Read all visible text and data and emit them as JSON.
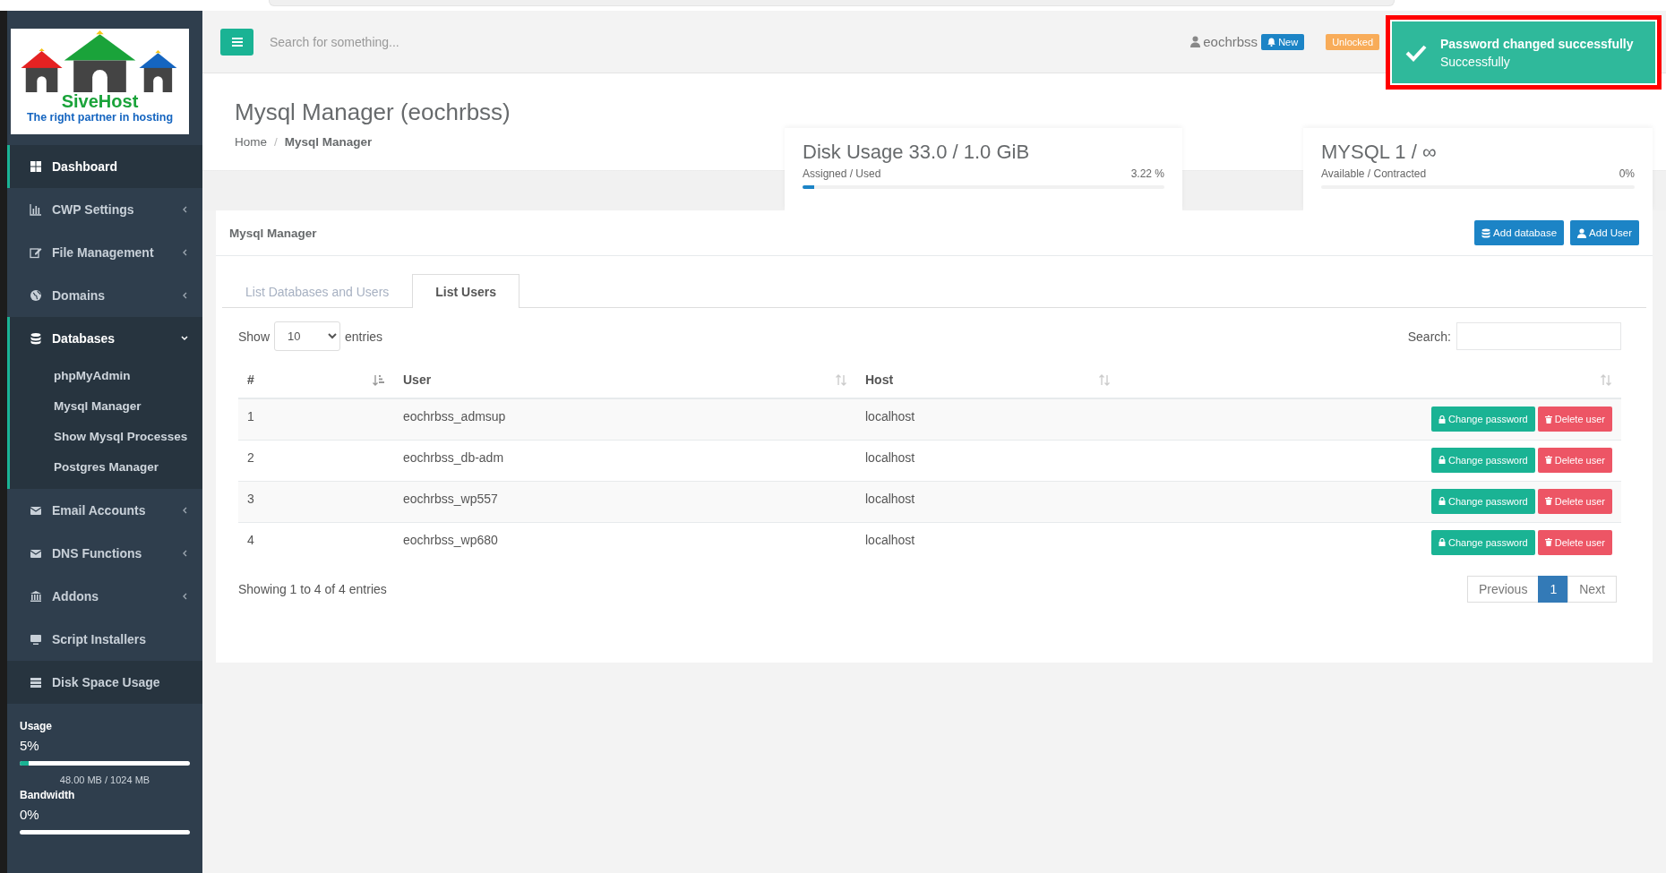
{
  "sidebar": {
    "logo": {
      "name": "SiveHost",
      "tagline": "The right partner in hosting"
    },
    "items": [
      {
        "label": "Dashboard",
        "selected": true,
        "shaded": true
      },
      {
        "label": "CWP Settings",
        "selected": false,
        "expanded": false,
        "shaded": false
      },
      {
        "label": "File Management",
        "selected": false,
        "expanded": false,
        "shaded": false
      },
      {
        "label": "Domains",
        "selected": false,
        "expanded": false,
        "shaded": false
      },
      {
        "label": "Databases",
        "selected": true,
        "expanded": true,
        "shaded": true,
        "children": [
          {
            "label": "phpMyAdmin"
          },
          {
            "label": "Mysql Manager"
          },
          {
            "label": "Show Mysql Processes"
          },
          {
            "label": "Postgres Manager"
          }
        ]
      },
      {
        "label": "Email Accounts",
        "selected": false,
        "expanded": false,
        "shaded": false
      },
      {
        "label": "DNS Functions",
        "selected": false,
        "expanded": false,
        "shaded": false
      },
      {
        "label": "Addons",
        "selected": false,
        "expanded": false,
        "shaded": false
      },
      {
        "label": "Script Installers",
        "selected": false,
        "shaded": false
      },
      {
        "label": "Disk Space Usage",
        "selected": false,
        "shaded": true
      }
    ],
    "meters": [
      {
        "title": "Usage",
        "reading": "5%",
        "level": 0.05,
        "detail": "48.00 MB / 1024 MB"
      },
      {
        "title": "Bandwidth",
        "reading": "0%",
        "level": 0
      }
    ]
  },
  "topbar": {
    "search": {
      "placeholder": "Search for something..."
    },
    "user": "eochrbss",
    "badges": [
      {
        "label": "New",
        "kind": "notify"
      },
      {
        "label": "Unlocked",
        "kind": "status"
      }
    ]
  },
  "toast": {
    "title": "Password changed successfully",
    "message": "Successfully"
  },
  "page": {
    "title": "Mysql Manager (eochrbss)",
    "separator": "/",
    "breadcrumb": [
      {
        "label": "Home",
        "current": false
      },
      {
        "label": "Mysql Manager",
        "current": true
      }
    ]
  },
  "stats": [
    {
      "title": "Disk Usage 33.0 / 1.0 GiB",
      "caption": "Assigned / Used",
      "reading": "3.22 %",
      "level": 0.0322
    },
    {
      "title": "MYSQL 1 / ∞",
      "caption": "Available / Contracted",
      "reading": "0%",
      "level": 0
    }
  ],
  "panel": {
    "title": "Mysql Manager",
    "buttons": [
      {
        "label": "Add database",
        "kind": "database"
      },
      {
        "label": "Add User",
        "kind": "user"
      }
    ],
    "tabs": [
      {
        "label": "List Databases and Users",
        "selected": false
      },
      {
        "label": "List Users",
        "selected": true
      }
    ],
    "length": {
      "before": "Show",
      "value": "10",
      "after": "entries"
    },
    "search_label": "Search:",
    "table": {
      "columns": [
        {
          "label": "#",
          "sorted": true
        },
        {
          "label": "User",
          "sorted": false
        },
        {
          "label": "Host",
          "sorted": false
        },
        {
          "sorted": false
        }
      ],
      "rows": [
        {
          "cells": [
            "1",
            "eochrbss_admsup",
            "localhost"
          ],
          "actions": [
            "Change password",
            "Delete user"
          ]
        },
        {
          "cells": [
            "2",
            "eochrbss_db-adm",
            "localhost"
          ],
          "actions": [
            "Change password",
            "Delete user"
          ]
        },
        {
          "cells": [
            "3",
            "eochrbss_wp557",
            "localhost"
          ],
          "actions": [
            "Change password",
            "Delete user"
          ]
        },
        {
          "cells": [
            "4",
            "eochrbss_wp680",
            "localhost"
          ],
          "actions": [
            "Change password",
            "Delete user"
          ]
        }
      ]
    },
    "info": "Showing 1 to 4 of 4 entries",
    "pagination": [
      {
        "label": "Previous",
        "selected": false
      },
      {
        "label": "1",
        "selected": true
      },
      {
        "label": "Next",
        "selected": false
      }
    ]
  }
}
